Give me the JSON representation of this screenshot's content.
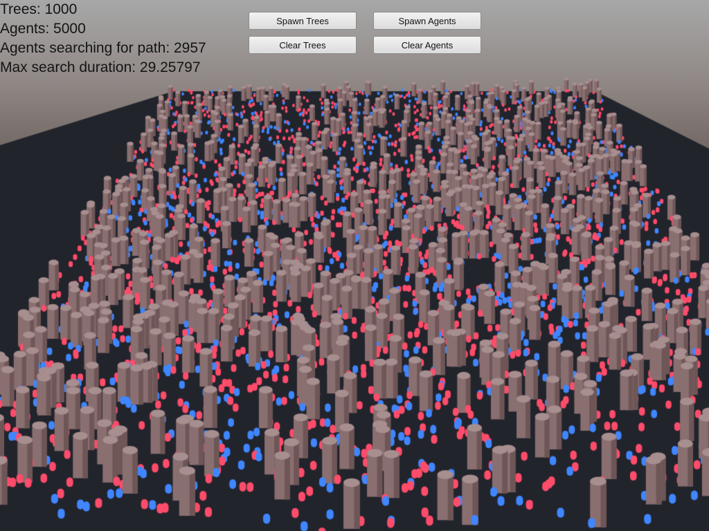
{
  "hud": {
    "trees": "Trees: 1000",
    "agents": "Agents: 5000",
    "searching": "Agents searching for path: 2957",
    "max_duration": "Max search duration: 29.25797"
  },
  "buttons": {
    "spawn_trees": "Spawn Trees",
    "spawn_agents": "Spawn Agents",
    "clear_trees": "Clear Trees",
    "clear_agents": "Clear Agents"
  },
  "scene": {
    "sky_color": "#a8a8a8",
    "horizon_color": "#6e6460",
    "ground_color": "#22242c",
    "tree_color": "#8a6f70",
    "agent_team_a_color": "#ff4c6a",
    "agent_team_b_color": "#3f86ff"
  }
}
